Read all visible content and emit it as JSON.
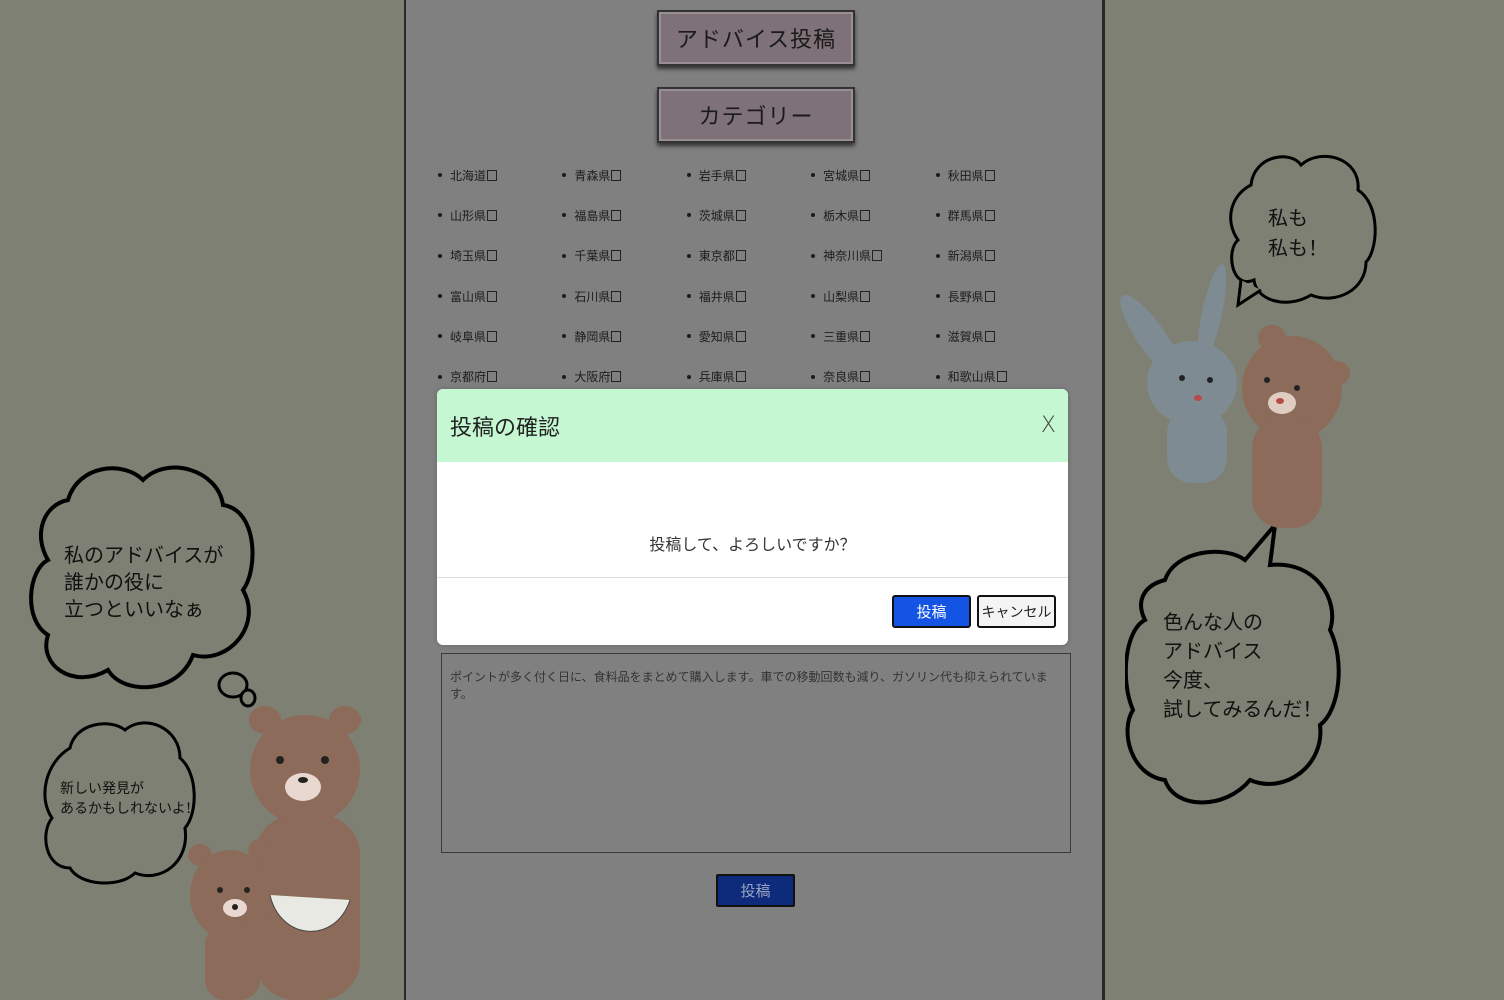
{
  "header": {
    "advice_post_button": "アドバイス投稿",
    "category_button": "カテゴリー"
  },
  "prefectures": [
    "北海道",
    "青森県",
    "岩手県",
    "宮城県",
    "秋田県",
    "山形県",
    "福島県",
    "茨城県",
    "栃木県",
    "群馬県",
    "埼玉県",
    "千葉県",
    "東京都",
    "神奈川県",
    "新潟県",
    "富山県",
    "石川県",
    "福井県",
    "山梨県",
    "長野県",
    "岐阜県",
    "静岡県",
    "愛知県",
    "三重県",
    "滋賀県",
    "京都府",
    "大阪府",
    "兵庫県",
    "奈良県",
    "和歌山県"
  ],
  "textarea": {
    "value": "ポイントが多く付く日に、食料品をまとめて購入します。車での移動回数も減り、ガソリン代も抑えられています。"
  },
  "submit_button": "投稿",
  "modal": {
    "title": "投稿の確認",
    "close_label": "X",
    "message": "投稿して、よろしいですか？",
    "confirm_label": "投稿",
    "cancel_label": "キャンセル"
  },
  "bubbles": {
    "left_top": [
      "私のアドバイスが",
      "誰かの役に",
      "立つといいなぁ"
    ],
    "left_bottom": [
      "新しい発見が",
      "あるかもしれないよ!"
    ],
    "right_top": [
      "私も",
      "私も！"
    ],
    "right_bottom": [
      "色んな人の",
      "アドバイス",
      "今度、",
      "試してみるんだ！"
    ]
  },
  "colors": {
    "modal_header": "#c5f7d2",
    "primary_button": "#1454e5",
    "overlay_center": "#808080"
  }
}
